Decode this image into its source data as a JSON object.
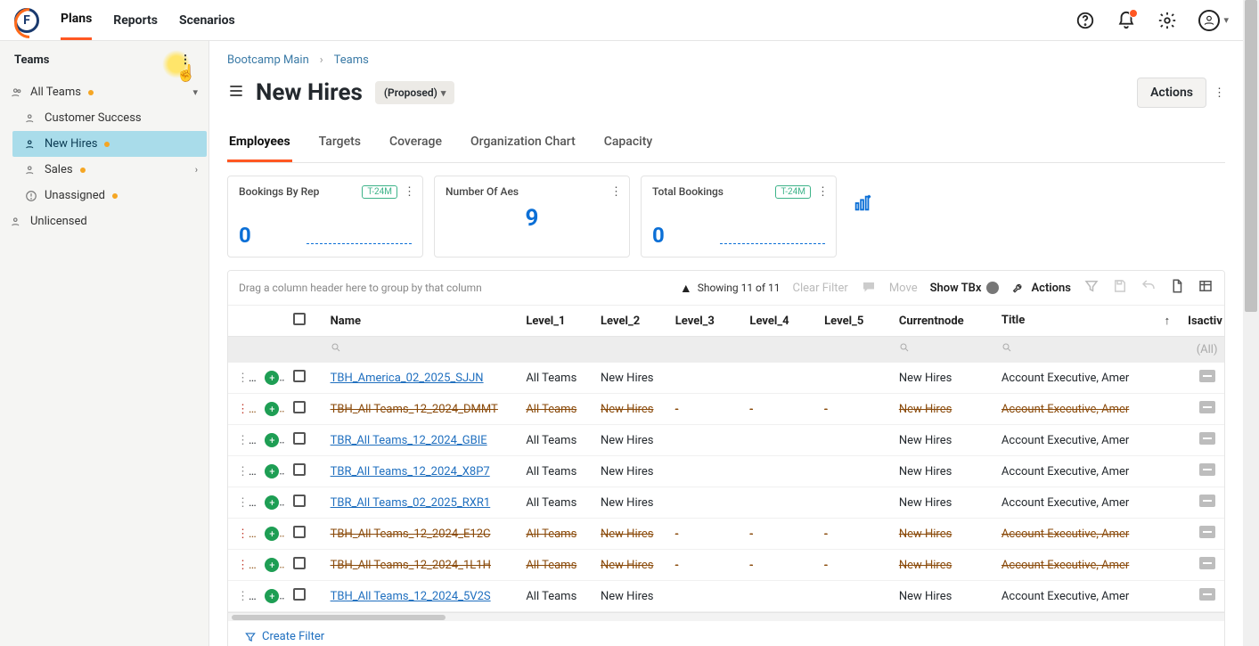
{
  "nav": {
    "plans": "Plans",
    "reports": "Reports",
    "scenarios": "Scenarios"
  },
  "sidebar": {
    "heading": "Teams",
    "all_teams": "All Teams",
    "customer_success": "Customer Success",
    "new_hires": "New Hires",
    "sales": "Sales",
    "unassigned": "Unassigned",
    "unlicensed": "Unlicensed"
  },
  "breadcrumb": {
    "root": "Bootcamp Main",
    "leaf": "Teams"
  },
  "page": {
    "title": "New Hires",
    "status_label": "(Proposed)",
    "actions_label": "Actions"
  },
  "tabs": {
    "employees": "Employees",
    "targets": "Targets",
    "coverage": "Coverage",
    "org_chart": "Organization Chart",
    "capacity": "Capacity"
  },
  "cards": {
    "bookings_by_rep": {
      "title": "Bookings By Rep",
      "badge": "T-24M",
      "value": "0"
    },
    "number_of_aes": {
      "title": "Number Of Aes",
      "value": "9"
    },
    "total_bookings": {
      "title": "Total Bookings",
      "badge": "T-24M",
      "value": "0"
    }
  },
  "grid": {
    "drag_hint": "Drag a column header here to group by that column",
    "showing": "Showing 11 of 11",
    "clear_filter": "Clear Filter",
    "move": "Move",
    "show_tbx": "Show TBx",
    "actions": "Actions",
    "all_filter": "(All)",
    "create_filter": "Create Filter",
    "cols": {
      "name": "Name",
      "l1": "Level_1",
      "l2": "Level_2",
      "l3": "Level_3",
      "l4": "Level_4",
      "l5": "Level_5",
      "currentnode": "Currentnode",
      "title": "Title",
      "isactive": "Isactiv"
    },
    "rows": [
      {
        "name": "TBH_America_02_2025_SJJN",
        "l1": "All Teams",
        "l2": "New Hires",
        "l3": "",
        "l4": "",
        "l5": "",
        "node": "New Hires",
        "title": "Account Executive, Amer",
        "strike": false
      },
      {
        "name": "TBH_All Teams_12_2024_DMMT",
        "l1": "All Teams",
        "l2": "New Hires",
        "l3": "-",
        "l4": "-",
        "l5": "-",
        "node": "New Hires",
        "title": "Account Executive, Amer",
        "strike": true
      },
      {
        "name": "TBR_All Teams_12_2024_GBIE",
        "l1": "All Teams",
        "l2": "New Hires",
        "l3": "",
        "l4": "",
        "l5": "",
        "node": "New Hires",
        "title": "Account Executive, Amer",
        "strike": false
      },
      {
        "name": "TBR_All Teams_12_2024_X8P7",
        "l1": "All Teams",
        "l2": "New Hires",
        "l3": "",
        "l4": "",
        "l5": "",
        "node": "New Hires",
        "title": "Account Executive, Amer",
        "strike": false
      },
      {
        "name": "TBR_All Teams_02_2025_RXR1",
        "l1": "All Teams",
        "l2": "New Hires",
        "l3": "",
        "l4": "",
        "l5": "",
        "node": "New Hires",
        "title": "Account Executive, Amer",
        "strike": false
      },
      {
        "name": "TBH_All Teams_12_2024_E12C",
        "l1": "All Teams",
        "l2": "New Hires",
        "l3": "-",
        "l4": "-",
        "l5": "-",
        "node": "New Hires",
        "title": "Account Executive, Amer",
        "strike": true
      },
      {
        "name": "TBH_All Teams_12_2024_1L1H",
        "l1": "All Teams",
        "l2": "New Hires",
        "l3": "-",
        "l4": "-",
        "l5": "-",
        "node": "New Hires",
        "title": "Account Executive, Amer",
        "strike": true
      },
      {
        "name": "TBH_All Teams_12_2024_5V2S",
        "l1": "All Teams",
        "l2": "New Hires",
        "l3": "",
        "l4": "",
        "l5": "",
        "node": "New Hires",
        "title": "Account Executive, Amer",
        "strike": false
      }
    ]
  }
}
